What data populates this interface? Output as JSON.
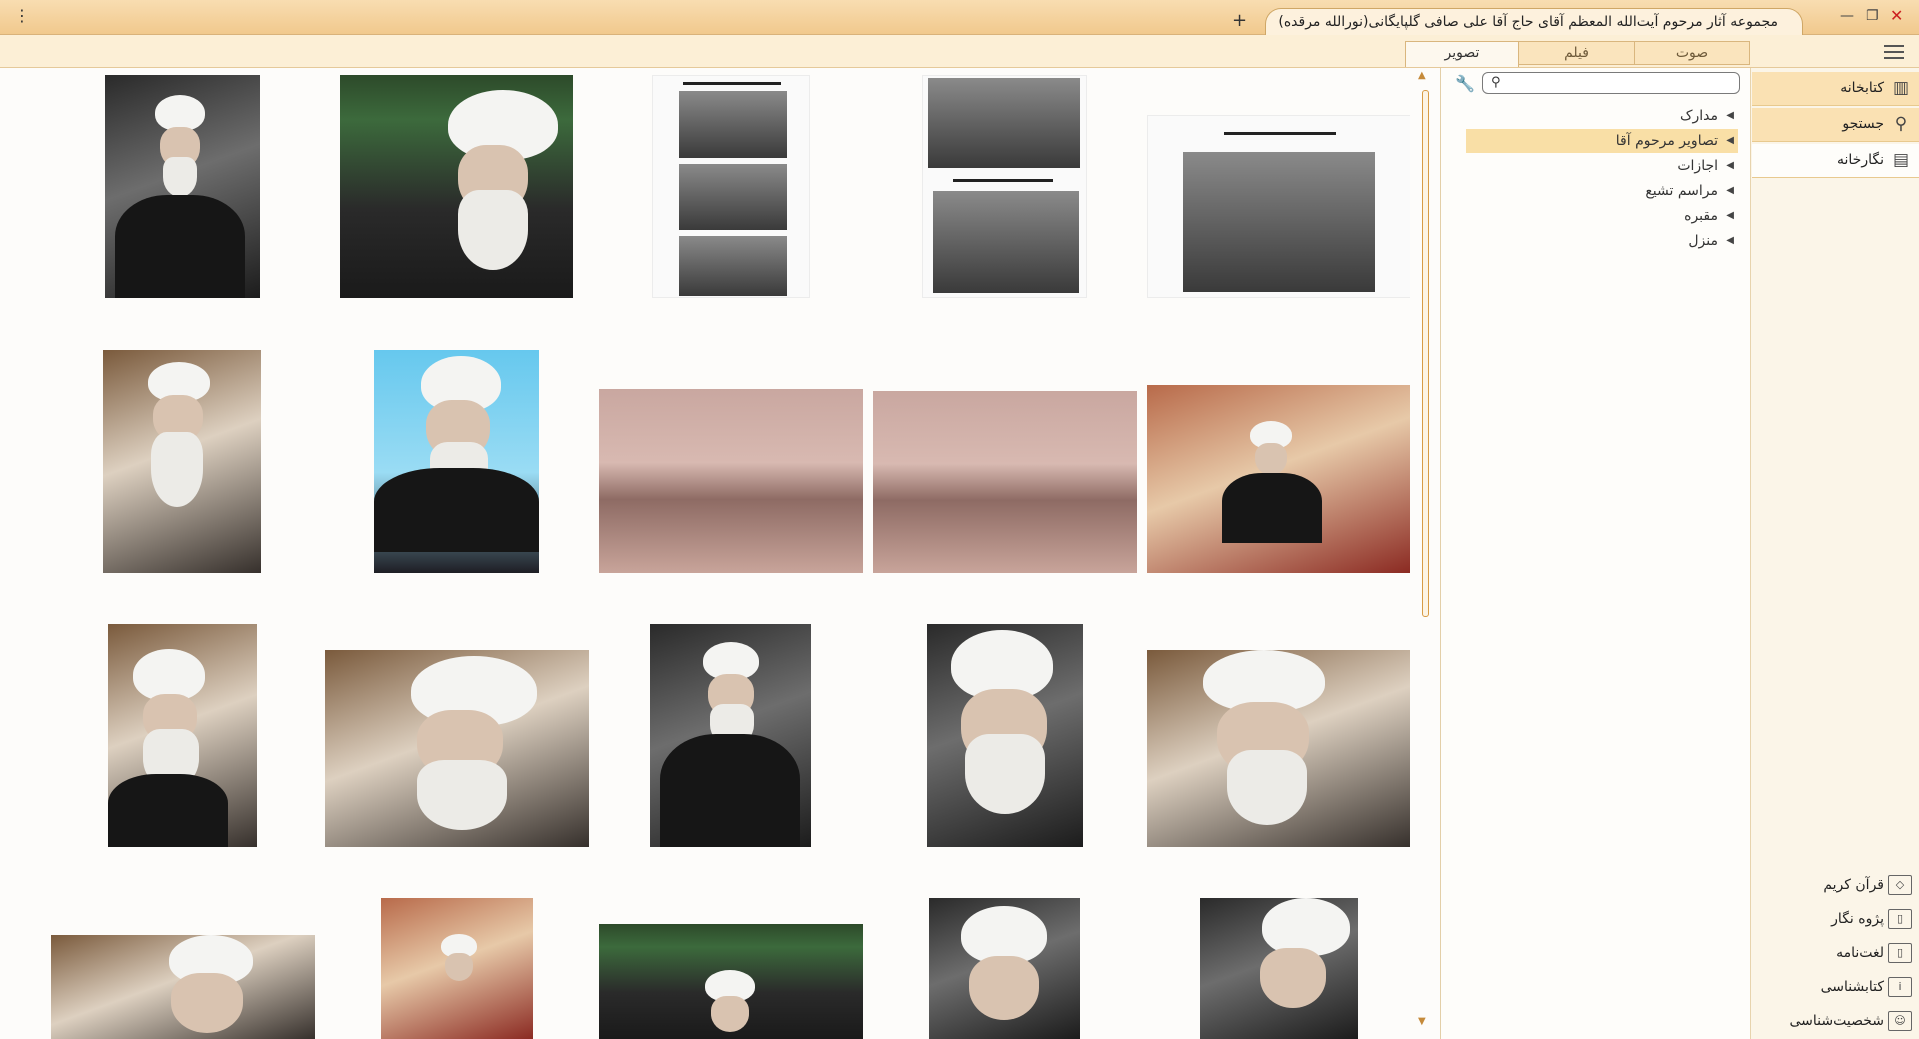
{
  "window": {
    "tab_title": "مجموعه آثار مرحوم آیت‌الله المعظم آقای حاج آقا علی صافی گلپایگانی(نورالله مرقده)",
    "new_tab": "+",
    "menu": "⋮",
    "min": "—",
    "max": "❐",
    "close": "✕"
  },
  "media_tabs": [
    {
      "label": "صوت"
    },
    {
      "label": "فیلم"
    },
    {
      "label": "تصویر"
    }
  ],
  "tree": {
    "search_placeholder": "",
    "items": [
      {
        "label": "مدارک"
      },
      {
        "label": "تصاویر مرحوم آقا"
      },
      {
        "label": "اجازات"
      },
      {
        "label": "مراسم تشیع"
      },
      {
        "label": "مقبره"
      },
      {
        "label": "منزل"
      }
    ]
  },
  "sidebar": {
    "main": [
      {
        "label": "کتابخانه",
        "icon": "library-icon"
      },
      {
        "label": "جستجو",
        "icon": "search-icon"
      },
      {
        "label": "نگارخانه",
        "icon": "gallery-icon"
      }
    ],
    "tools": [
      {
        "label": "قرآن کریم",
        "icon": "quran-icon"
      },
      {
        "label": "پژوه نگار",
        "icon": "notebook-icon"
      },
      {
        "label": "لغت‌نامه",
        "icon": "dictionary-icon"
      },
      {
        "label": "کتابشناسی",
        "icon": "info-icon"
      },
      {
        "label": "شخصیت‌شناسی",
        "icon": "person-icon"
      }
    ]
  },
  "colors": {
    "titlebar": "#f1c98d",
    "accent": "#f9dfa6",
    "close": "#cc2020"
  }
}
